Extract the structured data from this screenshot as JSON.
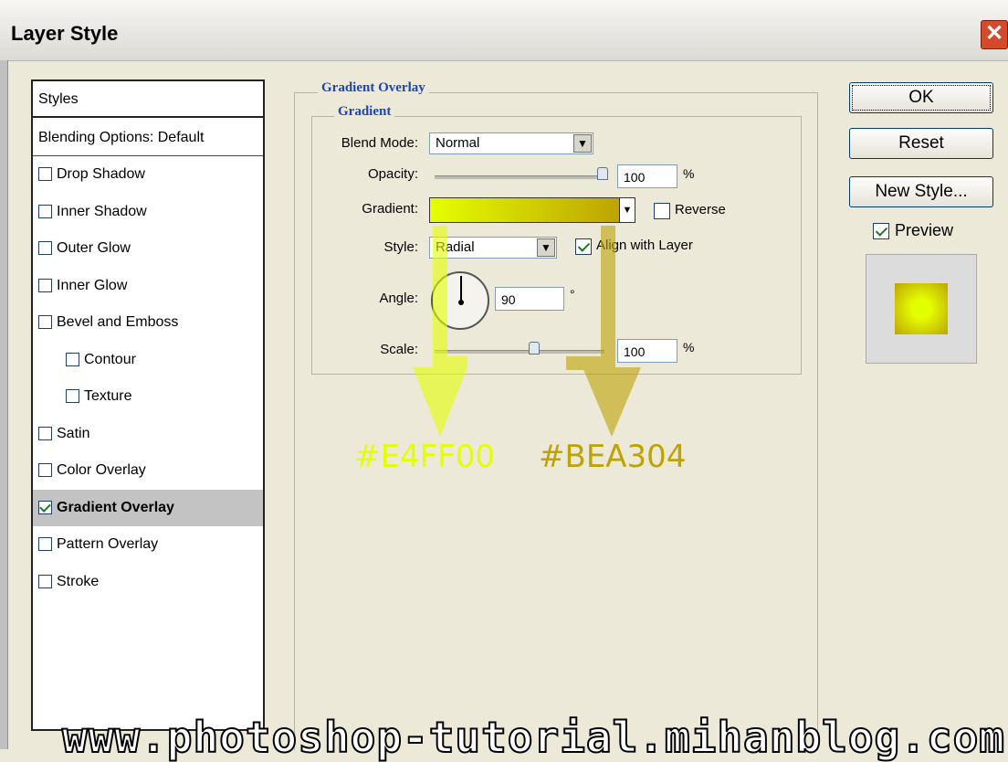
{
  "window": {
    "title": "Layer Style"
  },
  "colors": {
    "gradient_start": "#E4FF00",
    "gradient_end": "#BEA304"
  },
  "styles_list": {
    "header": "Styles",
    "blending_options": "Blending Options: Default",
    "items": [
      {
        "label": "Drop Shadow",
        "checked": false,
        "selected": false,
        "indent": false
      },
      {
        "label": "Inner Shadow",
        "checked": false,
        "selected": false,
        "indent": false
      },
      {
        "label": "Outer Glow",
        "checked": false,
        "selected": false,
        "indent": false
      },
      {
        "label": "Inner Glow",
        "checked": false,
        "selected": false,
        "indent": false
      },
      {
        "label": "Bevel and Emboss",
        "checked": false,
        "selected": false,
        "indent": false
      },
      {
        "label": "Contour",
        "checked": false,
        "selected": false,
        "indent": true
      },
      {
        "label": "Texture",
        "checked": false,
        "selected": false,
        "indent": true
      },
      {
        "label": "Satin",
        "checked": false,
        "selected": false,
        "indent": false
      },
      {
        "label": "Color Overlay",
        "checked": false,
        "selected": false,
        "indent": false
      },
      {
        "label": "Gradient Overlay",
        "checked": true,
        "selected": true,
        "indent": false
      },
      {
        "label": "Pattern Overlay",
        "checked": false,
        "selected": false,
        "indent": false
      },
      {
        "label": "Stroke",
        "checked": false,
        "selected": false,
        "indent": false
      }
    ]
  },
  "gradient_overlay": {
    "section_title": "Gradient Overlay",
    "subsection_title": "Gradient",
    "blend_mode_label": "Blend Mode:",
    "blend_mode_value": "Normal",
    "opacity_label": "Opacity:",
    "opacity_value": "100",
    "opacity_unit": "%",
    "opacity_level": 1.0,
    "gradient_label": "Gradient:",
    "reverse_label": "Reverse",
    "reverse_checked": false,
    "style_label": "Style:",
    "style_value": "Radial",
    "align_label": "Align with Layer",
    "align_checked": true,
    "angle_label": "Angle:",
    "angle_value": "90",
    "angle_unit": "°",
    "scale_label": "Scale:",
    "scale_value": "100",
    "scale_unit": "%",
    "scale_level": 0.5
  },
  "buttons": {
    "ok": "OK",
    "reset": "Reset",
    "new_style": "New Style..."
  },
  "preview": {
    "label": "Preview",
    "checked": true
  },
  "annotations": {
    "start_color_text": "#E4FF00",
    "end_color_text": "#BEA304"
  },
  "watermark": "www.photoshop-tutorial.mihanblog.com"
}
